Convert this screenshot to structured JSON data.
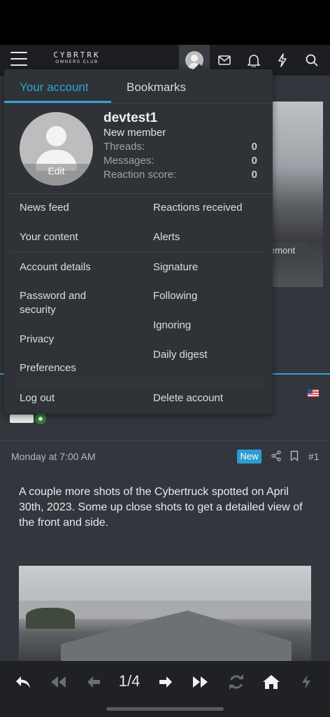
{
  "header": {
    "logo_line1": "CYBRTRK",
    "logo_line2": "OWNERS CLUB"
  },
  "account_menu": {
    "tabs": [
      {
        "label": "Your account",
        "active": true
      },
      {
        "label": "Bookmarks",
        "active": false
      }
    ],
    "avatar_edit_label": "Edit",
    "username": "devtest1",
    "user_title": "New member",
    "stats": [
      {
        "label": "Threads:",
        "value": "0"
      },
      {
        "label": "Messages:",
        "value": "0"
      },
      {
        "label": "Reaction score:",
        "value": "0"
      }
    ],
    "links": {
      "news_feed": "News feed",
      "reactions_received": "Reactions received",
      "your_content": "Your content",
      "alerts": "Alerts",
      "account_details": "Account details",
      "signature": "Signature",
      "password_security": "Password and security",
      "following": "Following",
      "ignoring": "Ignoring",
      "privacy": "Privacy",
      "daily_digest": "Daily digest",
      "preferences": "Preferences",
      "log_out": "Log out",
      "delete_account": "Delete account"
    }
  },
  "background": {
    "image_caption_fragment": "emont"
  },
  "post": {
    "date": "Monday at 7:00 AM",
    "new_badge": "New",
    "number": "#1",
    "body": "A couple more shots of the Cybertruck spotted on April 30th, 2023. Some up close shots to get a detailed view of the front and side."
  },
  "bottom_nav": {
    "page_counter": "1/4"
  },
  "colors": {
    "accent": "#2fa4d8",
    "menu_bg": "#2f3237",
    "page_bg": "#33363c",
    "online": "#2f7d3a"
  }
}
